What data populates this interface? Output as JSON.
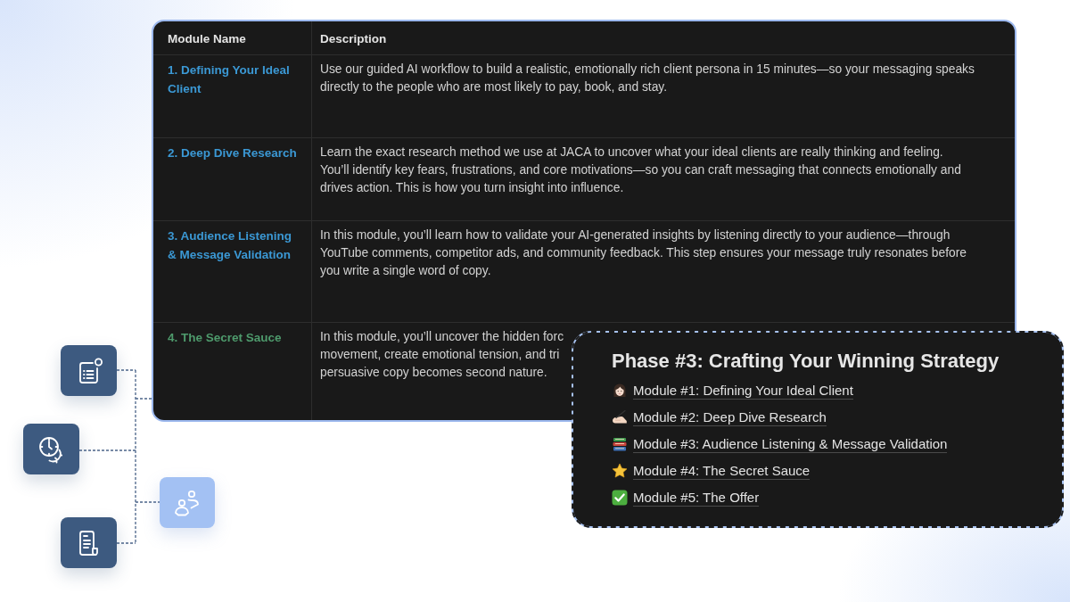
{
  "table": {
    "columns": [
      "Module Name",
      "Description"
    ],
    "rows": [
      {
        "name": "1. Defining Your Ideal Client",
        "color": "#3b98d4",
        "lines": [
          "Use our guided AI workflow to build a realistic, emotionally rich client persona in 15 minutes—so your messaging speaks",
          "directly to the people who are most likely to pay, book, and stay."
        ]
      },
      {
        "name": "2. Deep Dive Research",
        "color": "#3b98d4",
        "lines": [
          "Learn the exact research method we use at JACA to uncover what your ideal clients are really thinking and feeling.",
          "You’ll identify key fears, frustrations, and core motivations—so you can craft messaging that connects emotionally and",
          "drives action. This is how you turn insight into influence."
        ]
      },
      {
        "name": "3. Audience Listening & Message Validation",
        "color": "#3b98d4",
        "lines": [
          "In this module, you’ll learn how to validate your AI-generated insights by listening directly to your audience—through",
          "YouTube comments, competitor ads, and community feedback. This step ensures your message truly resonates before",
          "you write a single word of copy."
        ]
      },
      {
        "name": "4. The Secret Sauce",
        "color": "#4e9a6c",
        "lines": [
          "In this module, you’ll uncover the hidden forc",
          "movement, create emotional tension, and tri",
          "persuasive copy becomes second nature."
        ]
      }
    ]
  },
  "phase_card": {
    "title": "Phase #3: Crafting Your Winning Strategy",
    "items": [
      "Module #1: Defining Your Ideal Client",
      "Module #2: Deep Dive Research",
      "Module #3: Audience Listening & Message Validation",
      "Module #4: The Secret Sauce",
      "Module #5: The Offer"
    ]
  }
}
